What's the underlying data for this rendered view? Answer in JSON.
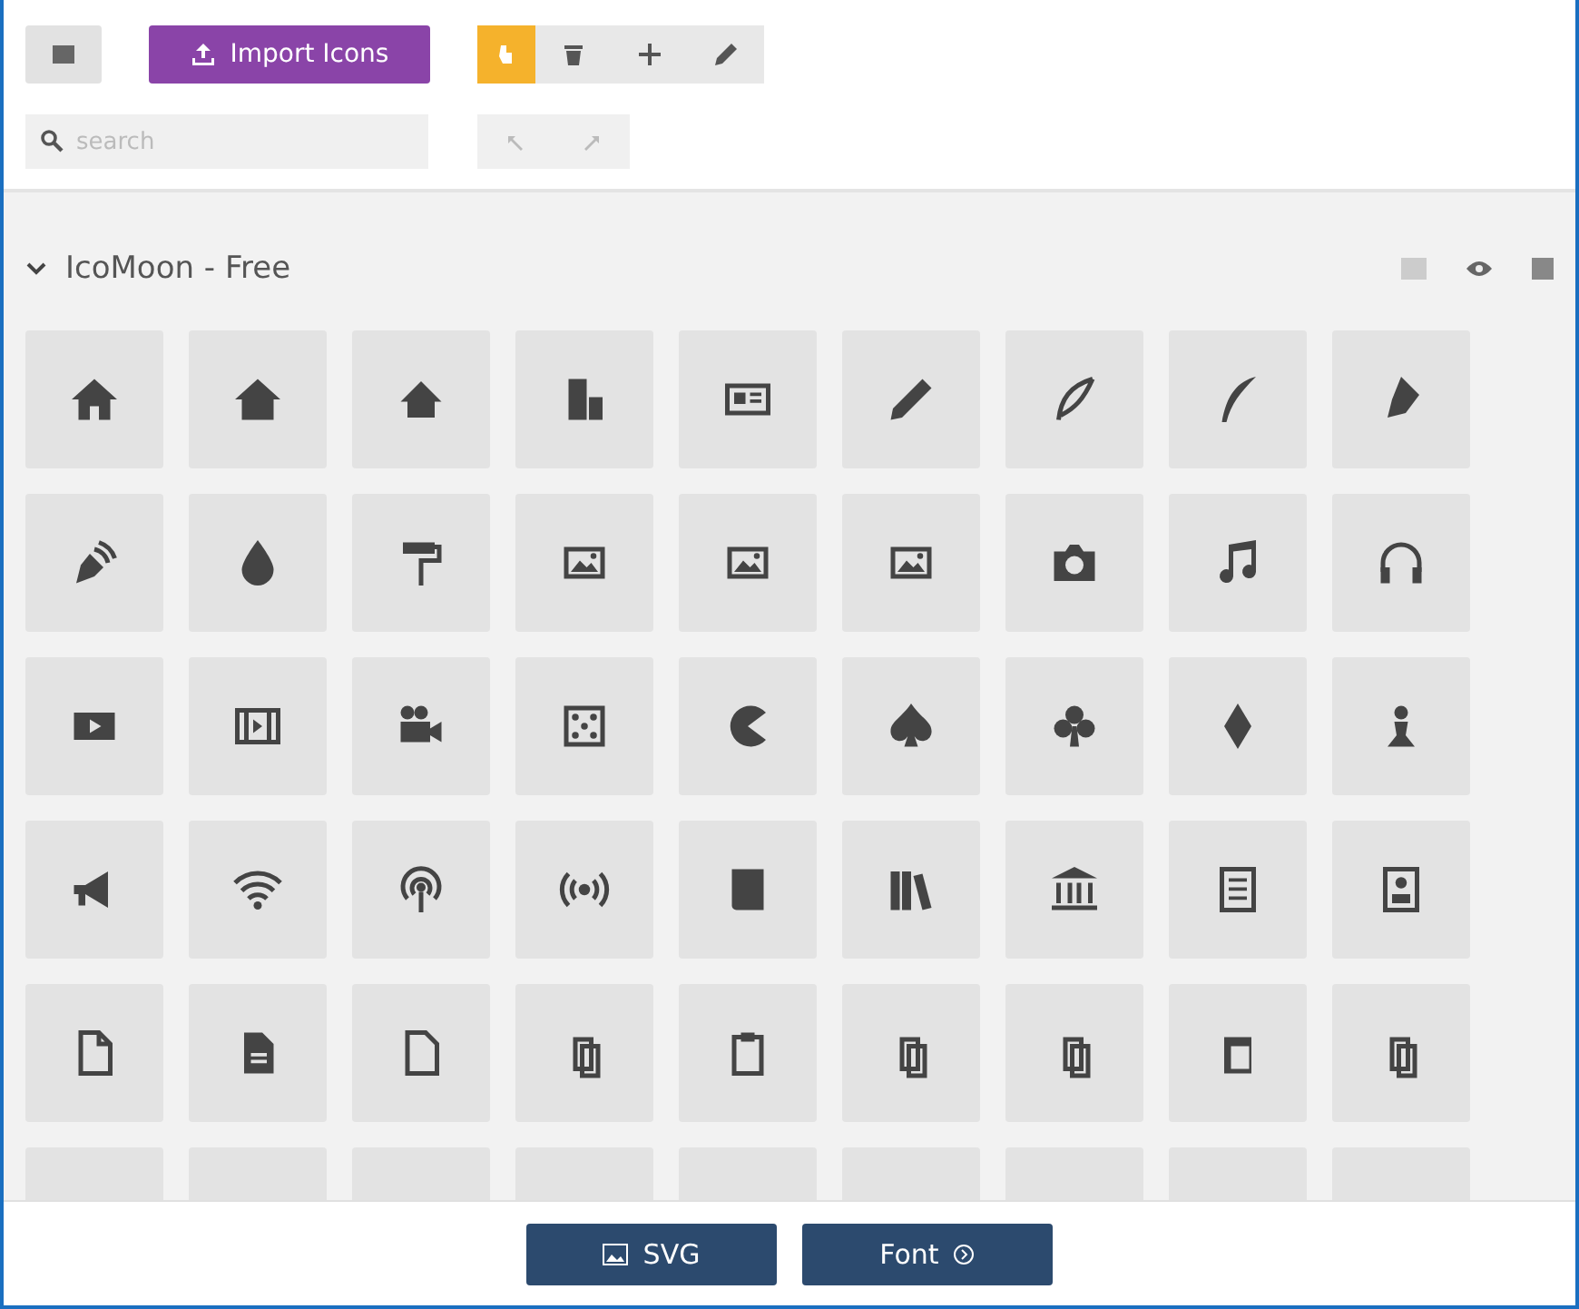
{
  "toolbar": {
    "import_button": {
      "label": "Import Icons"
    },
    "tools": [
      {
        "kind": "select",
        "selected": true
      },
      {
        "kind": "delete",
        "selected": false
      },
      {
        "kind": "add",
        "selected": false
      },
      {
        "kind": "edit",
        "selected": false
      }
    ],
    "search": {
      "placeholder": "search"
    }
  },
  "icon_set": {
    "title": "IcoMoon - Free",
    "expanded": true
  },
  "footer": {
    "buttons": [
      {
        "kind": "svg",
        "label": "SVG"
      },
      {
        "kind": "font",
        "label": "Font"
      }
    ]
  }
}
